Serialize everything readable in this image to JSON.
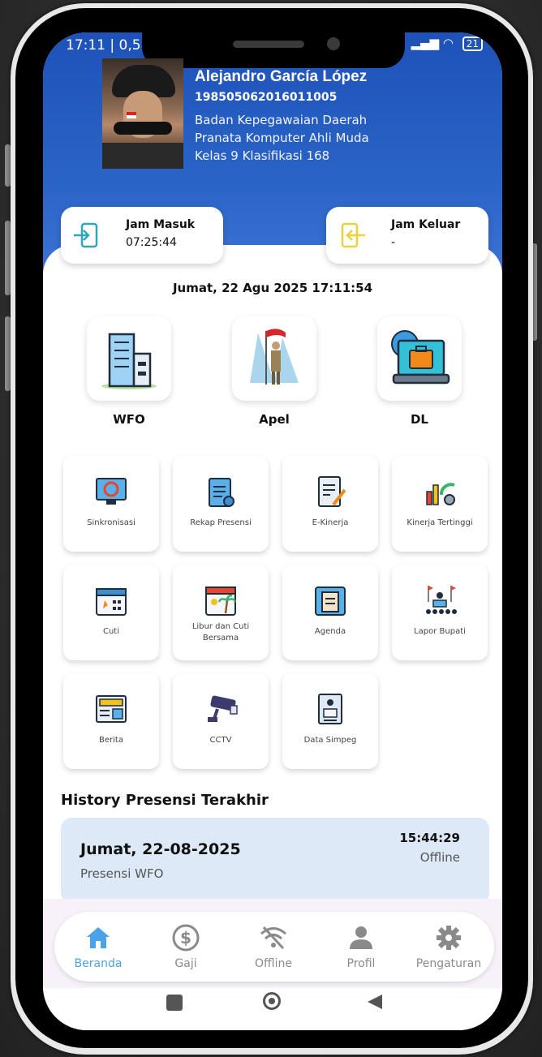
{
  "status_bar": {
    "time": "17:11 | 0,5",
    "battery": "21"
  },
  "profile": {
    "name": "Alejandro García López",
    "nip": "198505062016011005",
    "office": "Badan Kepegawaian Daerah",
    "position": "Pranata Komputer Ahli Muda",
    "class": "Kelas 9 Klasifikasi 168"
  },
  "attendance": {
    "check_in": {
      "label": "Jam Masuk",
      "value": "07:25:44"
    },
    "check_out": {
      "label": "Jam Keluar",
      "value": "-"
    }
  },
  "datetime": "Jumat, 22 Agu 2025 17:11:54",
  "main_actions": [
    {
      "label": "WFO"
    },
    {
      "label": "Apel"
    },
    {
      "label": "DL"
    }
  ],
  "menu": [
    {
      "label": "Sinkronisasi"
    },
    {
      "label": "Rekap Presensi"
    },
    {
      "label": "E-Kinerja"
    },
    {
      "label": "Kinerja Tertinggi"
    },
    {
      "label": "Cuti"
    },
    {
      "label": "Libur dan Cuti Bersama"
    },
    {
      "label": "Agenda"
    },
    {
      "label": "Lapor Bupati"
    },
    {
      "label": "Berita"
    },
    {
      "label": "CCTV"
    },
    {
      "label": "Data Simpeg"
    }
  ],
  "history": {
    "title": "History Presensi Terakhir",
    "items": [
      {
        "date": "Jumat, 22-08-2025",
        "type": "Presensi WFO",
        "time": "15:44:29",
        "status": "Offline"
      }
    ]
  },
  "bottom_nav": [
    {
      "label": "Beranda",
      "icon": "home-icon",
      "active": true
    },
    {
      "label": "Gaji",
      "icon": "dollar-icon",
      "active": false
    },
    {
      "label": "Offline",
      "icon": "wifi-off-icon",
      "active": false
    },
    {
      "label": "Profil",
      "icon": "person-icon",
      "active": false
    },
    {
      "label": "Pengaturan",
      "icon": "gear-icon",
      "active": false
    }
  ],
  "colors": {
    "header_blue": "#1e52b8",
    "active_nav": "#4aa3e6",
    "history_card_bg": "#dde9f7"
  }
}
